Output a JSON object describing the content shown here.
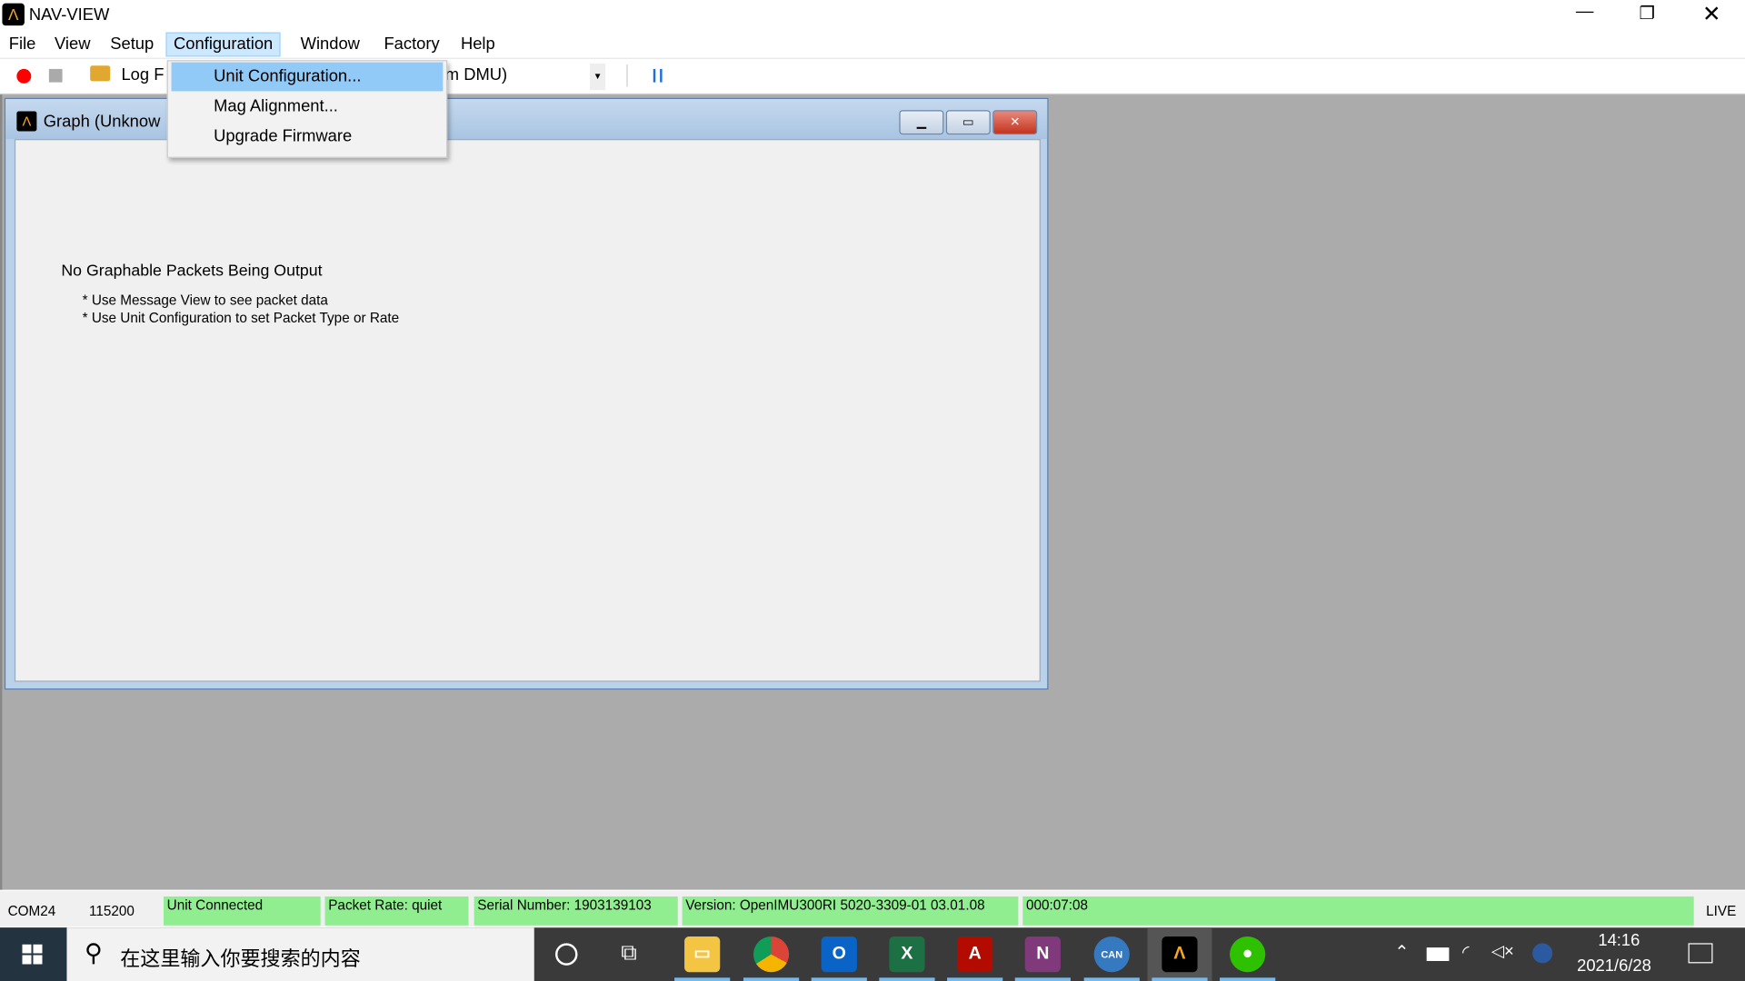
{
  "app": {
    "title": "NAV-VIEW"
  },
  "menubar": {
    "items": [
      "File",
      "View",
      "Setup",
      "Configuration",
      "Window",
      "Factory",
      "Help"
    ],
    "active": "Configuration"
  },
  "toolbar": {
    "log_label": "Log F",
    "source_text": "m DMU)"
  },
  "config_menu": {
    "items": [
      "Unit Configuration...",
      "Mag Alignment...",
      "Upgrade Firmware"
    ],
    "highlighted": "Unit Configuration..."
  },
  "graph_window": {
    "title": "Graph (Unknow",
    "message": "No Graphable Packets Being Output",
    "hints": [
      "* Use Message View to see packet data",
      "* Use Unit Configuration to set Packet Type or Rate"
    ]
  },
  "statusbar": {
    "port": "COM24",
    "baud": "115200",
    "connection": "Unit Connected",
    "packet_rate": "Packet Rate: quiet",
    "serial": "Serial Number: 1903139103",
    "version": "Version: OpenIMU300RI 5020-3309-01 03.01.08",
    "elapsed": "000:07:08",
    "mode": "LIVE",
    "status_color": "#90ee90"
  },
  "taskbar": {
    "search_placeholder": "在这里输入你要搜索的内容",
    "time": "14:16",
    "date": "2021/6/28",
    "apps": [
      "file-explorer",
      "chrome",
      "outlook",
      "excel",
      "acrobat",
      "onenote",
      "can-tool",
      "nav-view",
      "wechat"
    ]
  }
}
